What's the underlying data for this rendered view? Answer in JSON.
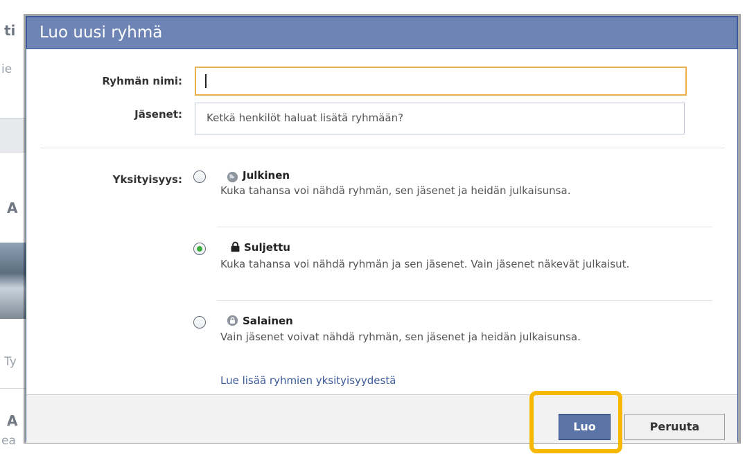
{
  "background": {
    "frag_1": "ti",
    "frag_2": "ie",
    "frag_3": "A",
    "frag_4": "Ty",
    "frag_5": "A",
    "frag_6": "ea"
  },
  "dialog": {
    "title": "Luo uusi ryhmä",
    "group_name": {
      "label": "Ryhmän nimi:",
      "value": ""
    },
    "members": {
      "label": "Jäsenet:",
      "placeholder": "Ketkä henkilöt haluat lisätä ryhmään?"
    },
    "privacy": {
      "label": "Yksityisyys:",
      "options": [
        {
          "title": "Julkinen",
          "description": "Kuka tahansa voi nähdä ryhmän, sen jäsenet ja heidän julkaisunsa.",
          "icon": "globe-icon",
          "checked": false
        },
        {
          "title": "Suljettu",
          "description": "Kuka tahansa voi nähdä ryhmän ja sen jäsenet. Vain jäsenet näkevät julkaisut.",
          "icon": "lock-icon",
          "checked": true
        },
        {
          "title": "Salainen",
          "description": "Vain jäsenet voivat nähdä ryhmän, sen jäsenet ja heidän julkaisunsa.",
          "icon": "secret-lock-icon",
          "checked": false
        }
      ],
      "learn_more": "Lue lisää ryhmien yksityisyydestä"
    },
    "buttons": {
      "create": "Luo",
      "cancel": "Peruuta"
    }
  },
  "colors": {
    "header": "#6d84b4",
    "primary_button": "#5b74a8",
    "highlight": "#f6b800",
    "selected_radio": "#3fae3f"
  }
}
